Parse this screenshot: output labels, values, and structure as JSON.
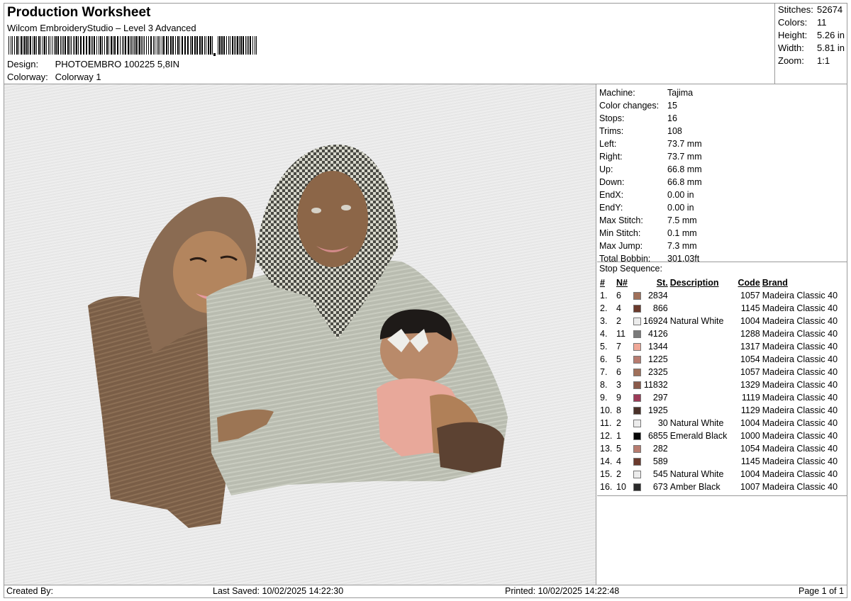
{
  "header": {
    "title": "Production Worksheet",
    "software": "Wilcom EmbroideryStudio – Level 3 Advanced",
    "design_label": "Design:",
    "design_value": "PHOTOEMBRO 100225 5,8IN",
    "colorway_label": "Colorway:",
    "colorway_value": "Colorway 1"
  },
  "stats": [
    {
      "k": "Stitches:",
      "v": "52674"
    },
    {
      "k": "Colors:",
      "v": "11"
    },
    {
      "k": "Height:",
      "v": "5.26 in"
    },
    {
      "k": "Width:",
      "v": "5.81 in"
    },
    {
      "k": "Zoom:",
      "v": "1:1"
    }
  ],
  "machine_info": [
    {
      "k": "Machine:",
      "v": "Tajima"
    },
    {
      "k": "Color changes:",
      "v": "15"
    },
    {
      "k": "Stops:",
      "v": "16"
    },
    {
      "k": "Trims:",
      "v": "108"
    },
    {
      "k": "Left:",
      "v": "73.7 mm"
    },
    {
      "k": "Right:",
      "v": "73.7 mm"
    },
    {
      "k": "Up:",
      "v": "66.8 mm"
    },
    {
      "k": "Down:",
      "v": "66.8 mm"
    },
    {
      "k": "EndX:",
      "v": "0.00 in"
    },
    {
      "k": "EndY:",
      "v": "0.00 in"
    },
    {
      "k": "Max Stitch:",
      "v": "7.5 mm"
    },
    {
      "k": "Min Stitch:",
      "v": "0.1 mm"
    },
    {
      "k": "Max Jump:",
      "v": "7.3 mm"
    },
    {
      "k": "Total Bobbin:",
      "v": "301.03ft"
    }
  ],
  "stop_sequence": {
    "title": "Stop Sequence:",
    "columns": [
      "#",
      "N#",
      "St.",
      "Description",
      "Code",
      "Brand"
    ],
    "rows": [
      {
        "idx": "1.",
        "n": "6",
        "color": "#a0705a",
        "st": "2834",
        "desc": "",
        "code": "1057",
        "brand": "Madeira Classic 40"
      },
      {
        "idx": "2.",
        "n": "4",
        "color": "#6b3a2c",
        "st": "866",
        "desc": "",
        "code": "1145",
        "brand": "Madeira Classic 40"
      },
      {
        "idx": "3.",
        "n": "2",
        "color": "#ececec",
        "st": "16924",
        "desc": "Natural White",
        "code": "1004",
        "brand": "Madeira Classic 40"
      },
      {
        "idx": "4.",
        "n": "11",
        "color": "#7a7a7a",
        "st": "4126",
        "desc": "",
        "code": "1288",
        "brand": "Madeira Classic 40"
      },
      {
        "idx": "5.",
        "n": "7",
        "color": "#f0a898",
        "st": "1344",
        "desc": "",
        "code": "1317",
        "brand": "Madeira Classic 40"
      },
      {
        "idx": "6.",
        "n": "5",
        "color": "#b87c70",
        "st": "1225",
        "desc": "",
        "code": "1054",
        "brand": "Madeira Classic 40"
      },
      {
        "idx": "7.",
        "n": "6",
        "color": "#a0705a",
        "st": "2325",
        "desc": "",
        "code": "1057",
        "brand": "Madeira Classic 40"
      },
      {
        "idx": "8.",
        "n": "3",
        "color": "#8a5a4a",
        "st": "11832",
        "desc": "",
        "code": "1329",
        "brand": "Madeira Classic 40"
      },
      {
        "idx": "9.",
        "n": "9",
        "color": "#9c3a58",
        "st": "297",
        "desc": "",
        "code": "1119",
        "brand": "Madeira Classic 40"
      },
      {
        "idx": "10.",
        "n": "8",
        "color": "#4a3028",
        "st": "1925",
        "desc": "",
        "code": "1129",
        "brand": "Madeira Classic 40"
      },
      {
        "idx": "11.",
        "n": "2",
        "color": "#ececec",
        "st": "30",
        "desc": "Natural White",
        "code": "1004",
        "brand": "Madeira Classic 40"
      },
      {
        "idx": "12.",
        "n": "1",
        "color": "#050505",
        "st": "6855",
        "desc": "Emerald Black",
        "code": "1000",
        "brand": "Madeira Classic 40"
      },
      {
        "idx": "13.",
        "n": "5",
        "color": "#b87c70",
        "st": "282",
        "desc": "",
        "code": "1054",
        "brand": "Madeira Classic 40"
      },
      {
        "idx": "14.",
        "n": "4",
        "color": "#6b3a2c",
        "st": "589",
        "desc": "",
        "code": "1145",
        "brand": "Madeira Classic 40"
      },
      {
        "idx": "15.",
        "n": "2",
        "color": "#ececec",
        "st": "545",
        "desc": "Natural White",
        "code": "1004",
        "brand": "Madeira Classic 40"
      },
      {
        "idx": "16.",
        "n": "10",
        "color": "#2a2a2a",
        "st": "673",
        "desc": "Amber Black",
        "code": "1007",
        "brand": "Madeira Classic 40"
      }
    ]
  },
  "footer": {
    "created_by": "Created By:",
    "last_saved": "Last Saved: 10/02/2025 14:22:30",
    "printed": "Printed: 10/02/2025 14:22:48",
    "page": "Page 1 of 1"
  }
}
